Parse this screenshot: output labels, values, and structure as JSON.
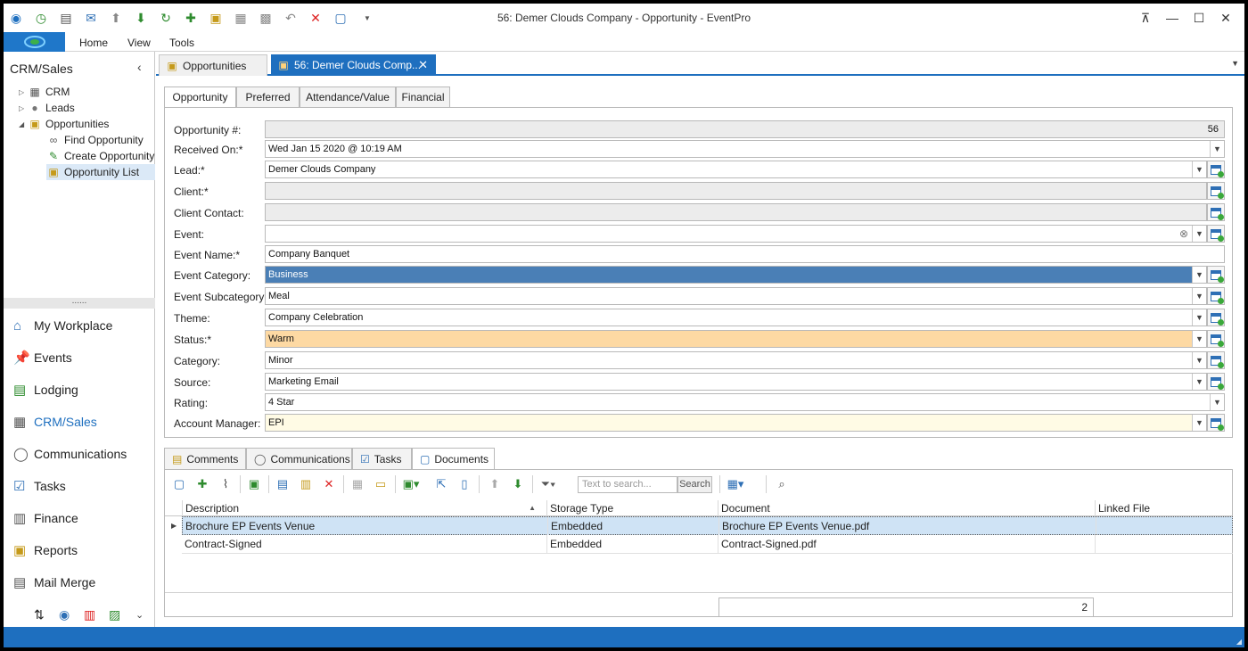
{
  "window": {
    "title": "56: Demer Clouds Company - Opportunity - EventPro"
  },
  "menu": {
    "items": [
      "Home",
      "View",
      "Tools"
    ]
  },
  "left_panel": {
    "title": "CRM/Sales",
    "tree": {
      "crm": "CRM",
      "leads": "Leads",
      "opportunities": "Opportunities",
      "find": "Find Opportunity",
      "create": "Create Opportunity",
      "list": "Opportunity List"
    },
    "splitter": "......",
    "nav": [
      "My Workplace",
      "Events",
      "Lodging",
      "CRM/Sales",
      "Communications",
      "Tasks",
      "Finance",
      "Reports",
      "Mail Merge"
    ]
  },
  "doc_tabs": {
    "tab1": "Opportunities",
    "tab2": "56: Demer Clouds Comp...",
    "close": "✕"
  },
  "form_tabs": [
    "Opportunity",
    "Preferred",
    "Attendance/Value",
    "Financial"
  ],
  "form": {
    "opportunity_no": {
      "label": "Opportunity #:",
      "value": "56"
    },
    "received_on": {
      "label": "Received On:*",
      "value": "Wed Jan 15 2020 @ 10:19 AM"
    },
    "lead": {
      "label": "Lead:*",
      "value": "Demer Clouds Company"
    },
    "client": {
      "label": "Client:*",
      "value": ""
    },
    "client_contact": {
      "label": "Client Contact:",
      "value": ""
    },
    "event": {
      "label": "Event:",
      "value": ""
    },
    "event_name": {
      "label": "Event Name:*",
      "value": "Company Banquet"
    },
    "event_category": {
      "label": "Event Category:",
      "value": "Business"
    },
    "event_subcategory": {
      "label": "Event Subcategory:",
      "value": "Meal"
    },
    "theme": {
      "label": "Theme:",
      "value": "Company Celebration"
    },
    "status": {
      "label": "Status:*",
      "value": "Warm"
    },
    "category": {
      "label": "Category:",
      "value": "Minor"
    },
    "source": {
      "label": "Source:",
      "value": "Marketing Email"
    },
    "rating": {
      "label": "Rating:",
      "value": "4 Star"
    },
    "account_manager": {
      "label": "Account Manager:",
      "value": "EPI"
    }
  },
  "bottom_tabs": [
    "Comments",
    "Communications",
    "Tasks",
    "Documents"
  ],
  "toolbar": {
    "search_placeholder": "Text to search...",
    "search_button": "Search"
  },
  "grid": {
    "columns": [
      "Description",
      "Storage Type",
      "Document",
      "Linked File"
    ],
    "rows": [
      [
        "Brochure EP Events Venue",
        "Embedded",
        "Brochure EP Events Venue.pdf",
        ""
      ],
      [
        "Contract-Signed",
        "Embedded",
        "Contract-Signed.pdf",
        ""
      ]
    ],
    "count": "2"
  },
  "colors": {
    "accent": "#1e6fbf",
    "category_fill": "#4a7fb6",
    "status_fill": "#fdd9a3",
    "account_fill": "#fffbe5"
  }
}
